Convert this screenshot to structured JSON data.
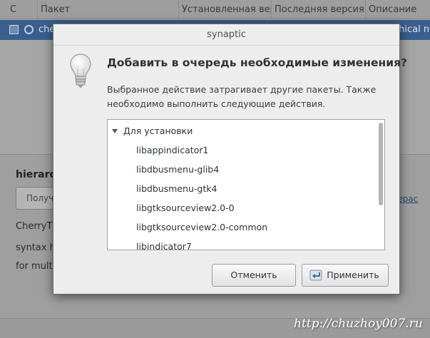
{
  "background": {
    "columns": {
      "s": "С",
      "package": "Пакет",
      "installed": "Установленная вер",
      "latest": "Последняя версия",
      "description": "Описание"
    },
    "row": {
      "package": "che",
      "desc_tail": "chical n"
    },
    "panel_title": "hierarc",
    "get_button": "Получ",
    "link_tail": "отерас",
    "text_lines": [
      "CherryT",
      "syntax h",
      "for mult"
    ]
  },
  "dialog": {
    "title": "synaptic",
    "heading": "Добавить в очередь необходимые изменения?",
    "message": "Выбранное действие затрагивает другие пакеты. Также необходимо выполнить следующие действия.",
    "group": "Для установки",
    "packages": [
      "libappindicator1",
      "libdbusmenu-glib4",
      "libdbusmenu-gtk4",
      "libgtksourceview2.0-0",
      "libgtksourceview2.0-common",
      "libindicator7"
    ],
    "cancel_label": "Отменить",
    "apply_label": "Применить"
  },
  "watermark": "http://chuzhoy007.ru",
  "icons": {
    "info": "lightbulb-icon",
    "apply": "apply-arrow-icon",
    "expander": "triangle-down-icon"
  },
  "colors": {
    "selection": "#3a5f8f",
    "dialog_bg": "#ededed",
    "list_bg": "#ffffff"
  }
}
